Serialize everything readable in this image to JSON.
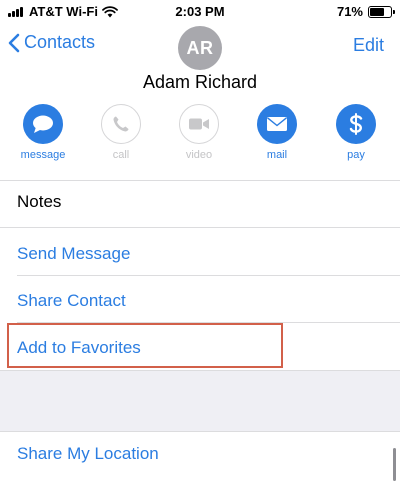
{
  "status_bar": {
    "carrier": "AT&T Wi-Fi",
    "time": "2:03 PM",
    "battery": "71%",
    "battery_level": 0.71,
    "icons": [
      "signal-icon",
      "wifi-icon",
      "battery-icon"
    ]
  },
  "nav": {
    "back_label": "Contacts",
    "edit_label": "Edit",
    "avatar_initials": "AR"
  },
  "contact": {
    "name": "Adam Richard"
  },
  "actions": [
    {
      "label": "message",
      "icon": "message-bubble-icon",
      "enabled": true
    },
    {
      "label": "call",
      "icon": "phone-icon",
      "enabled": false
    },
    {
      "label": "video",
      "icon": "video-camera-icon",
      "enabled": false
    },
    {
      "label": "mail",
      "icon": "envelope-icon",
      "enabled": true
    },
    {
      "label": "pay",
      "icon": "dollar-icon",
      "enabled": true
    }
  ],
  "rows": {
    "notes": "Notes",
    "send_message": "Send Message",
    "share_contact": "Share Contact",
    "add_to_favorites": "Add to Favorites",
    "share_my_location": "Share My Location"
  },
  "colors": {
    "accent": "#2b7de1",
    "highlight_border": "#d2604a",
    "section_gap": "#efeff4",
    "avatar_bg": "#a8a8ad"
  }
}
